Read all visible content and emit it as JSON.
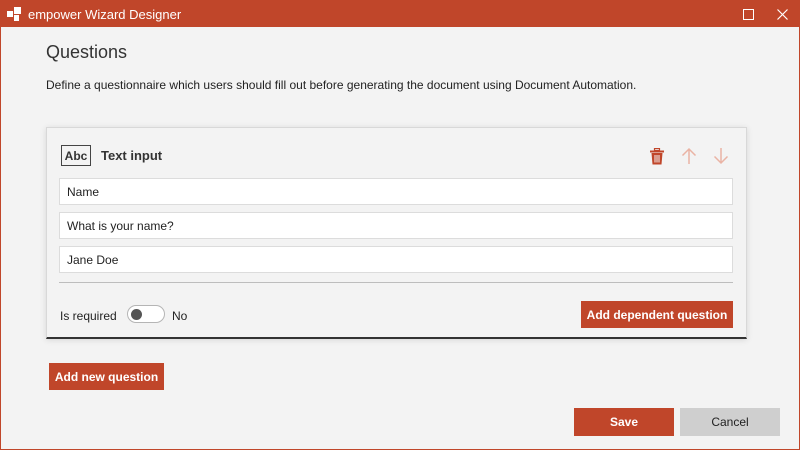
{
  "window": {
    "title": "empower Wizard Designer"
  },
  "page": {
    "title": "Questions",
    "description": "Define a questionnaire which users should fill out before generating the document using Document Automation."
  },
  "question": {
    "type_icon": "Abc",
    "type_label": "Text input",
    "fields": {
      "name": "Name",
      "question_text": "What is your name?",
      "default_value": "Jane Doe"
    },
    "required_label": "Is required",
    "required_value": "No",
    "add_dependent_label": "Add dependent question"
  },
  "actions": {
    "add_new_label": "Add new question",
    "save_label": "Save",
    "cancel_label": "Cancel"
  },
  "colors": {
    "accent": "#c0462a",
    "background": "#f3f3f3"
  }
}
